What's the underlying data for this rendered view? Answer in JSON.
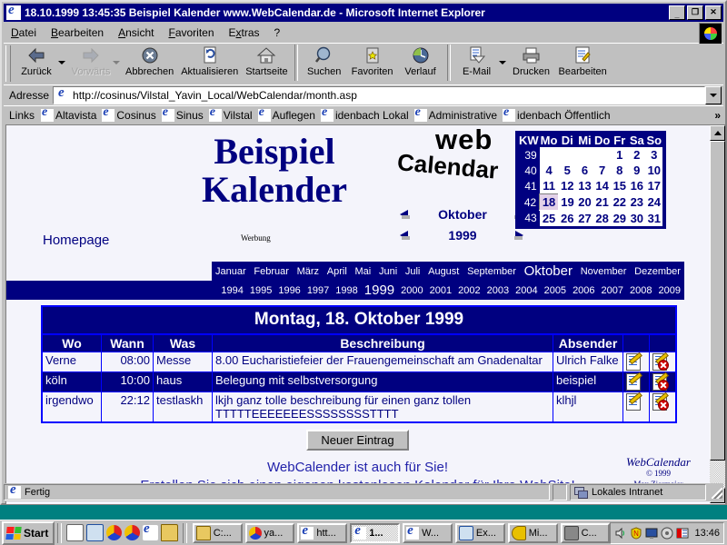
{
  "window": {
    "title": "18.10.1999 13:45:35 Beispiel Kalender www.WebCalendar.de - Microsoft Internet Explorer",
    "minimize_label": "_",
    "restore_label": "❐",
    "close_label": "✕"
  },
  "menubar": {
    "items": [
      {
        "label": "Datei"
      },
      {
        "label": "Bearbeiten"
      },
      {
        "label": "Ansicht"
      },
      {
        "label": "Favoriten"
      },
      {
        "label": "Extras"
      },
      {
        "label": "?"
      }
    ]
  },
  "toolbar": {
    "buttons": [
      {
        "label": "Zurück",
        "icon": "back-arrow-icon",
        "disabled": false,
        "dropdown": true
      },
      {
        "label": "Vorwärts",
        "icon": "forward-arrow-icon",
        "disabled": true,
        "dropdown": true
      },
      {
        "label": "Abbrechen",
        "icon": "stop-icon",
        "disabled": false
      },
      {
        "label": "Aktualisieren",
        "icon": "refresh-icon",
        "disabled": false
      },
      {
        "label": "Startseite",
        "icon": "home-icon",
        "disabled": false
      },
      {
        "label": "Suchen",
        "icon": "search-icon",
        "disabled": false
      },
      {
        "label": "Favoriten",
        "icon": "favorites-star-icon",
        "disabled": false
      },
      {
        "label": "Verlauf",
        "icon": "history-clock-icon",
        "disabled": false
      },
      {
        "label": "E-Mail",
        "icon": "mail-icon",
        "disabled": false,
        "dropdown": true
      },
      {
        "label": "Drucken",
        "icon": "printer-icon",
        "disabled": false
      },
      {
        "label": "Bearbeiten",
        "icon": "edit-page-icon",
        "disabled": false
      }
    ]
  },
  "address": {
    "label": "Adresse",
    "url": "http://cosinus/Vilstal_Yavin_Local/WebCalendar/month.asp"
  },
  "links": {
    "label": "Links",
    "items": [
      {
        "label": "Altavista"
      },
      {
        "label": "Cosinus"
      },
      {
        "label": "Sinus"
      },
      {
        "label": "Vilstal"
      },
      {
        "label": "Auflegen"
      },
      {
        "label": "idenbach Lokal"
      },
      {
        "label": "Administrative"
      },
      {
        "label": "idenbach Öffentlich"
      }
    ],
    "overflow": "»"
  },
  "page": {
    "title_line1": "Beispiel",
    "title_line2": "Kalender",
    "homepage_link": "Homepage",
    "ad_label": "Werbung",
    "logo": {
      "word1": "web",
      "word2": "Calendar"
    },
    "nav": {
      "month": "Oktober",
      "year": "1999",
      "prev_symbol": "◀",
      "next_symbol": "▶"
    },
    "minical": {
      "headers": [
        "KW",
        "Mo",
        "Di",
        "Mi",
        "Do",
        "Fr",
        "Sa",
        "So"
      ],
      "selected_day": "18",
      "rows": [
        {
          "kw": "39",
          "days": [
            "",
            "",
            "",
            "",
            "1",
            "2",
            "3"
          ]
        },
        {
          "kw": "40",
          "days": [
            "4",
            "5",
            "6",
            "7",
            "8",
            "9",
            "10"
          ]
        },
        {
          "kw": "41",
          "days": [
            "11",
            "12",
            "13",
            "14",
            "15",
            "16",
            "17"
          ]
        },
        {
          "kw": "42",
          "days": [
            "18",
            "19",
            "20",
            "21",
            "22",
            "23",
            "24"
          ]
        },
        {
          "kw": "43",
          "days": [
            "25",
            "26",
            "27",
            "28",
            "29",
            "30",
            "31"
          ]
        }
      ]
    },
    "months": [
      "Januar",
      "Februar",
      "März",
      "April",
      "Mai",
      "Juni",
      "Juli",
      "August",
      "September",
      "Oktober",
      "November",
      "Dezember"
    ],
    "current_month": "Oktober",
    "years": [
      "1994",
      "1995",
      "1996",
      "1997",
      "1998",
      "1999",
      "2000",
      "2001",
      "2002",
      "2003",
      "2004",
      "2005",
      "2006",
      "2007",
      "2008",
      "2009"
    ],
    "current_year": "1999",
    "day_title": "Montag, 18. Oktober 1999",
    "table": {
      "headers": [
        "Wo",
        "Wann",
        "Was",
        "Beschreibung",
        "Absender"
      ],
      "rows": [
        {
          "wo": "Verne",
          "wann": "08:00",
          "was": "Messe",
          "beschreibung": "8.00 Eucharistiefeier der Frauengemeinschaft am Gnadenaltar",
          "absender": "Ulrich Falke",
          "highlighted": false
        },
        {
          "wo": "köln",
          "wann": "10:00",
          "was": "haus",
          "beschreibung": "Belegung mit selbstversorgung",
          "absender": "beispiel",
          "highlighted": true
        },
        {
          "wo": "irgendwo",
          "wann": "22:12",
          "was": "testlaskh",
          "beschreibung": "lkjh ganz tolle beschreibung für einen ganz tollen TTTTTEEEEEEESSSSSSSSTTTT",
          "absender": "klhjl",
          "highlighted": false
        }
      ],
      "edit_icon": "edit-entry-icon",
      "delete_icon": "delete-entry-icon"
    },
    "new_entry_button": "Neuer Eintrag",
    "footer_line1": "WebCalender ist auch für Sie!",
    "footer_line2": "Erstellen Sie sich einen eigenen kostenlosen Kalender für Ihre WebSite!",
    "signature": {
      "name": "WebCalendar",
      "copyright": "© 1999",
      "author": "Max Ziermaier"
    }
  },
  "statusbar": {
    "status": "Fertig",
    "zone": "Lokales Intranet"
  },
  "taskbar": {
    "start_label": "Start",
    "quicklaunch": [
      {
        "icon": "notepad-icon"
      },
      {
        "icon": "magnifier-icon"
      },
      {
        "icon": "media-icon"
      },
      {
        "icon": "network-icon"
      },
      {
        "icon": "internet-explorer-icon"
      },
      {
        "icon": "folder-icon"
      }
    ],
    "tasks": [
      {
        "label": "C:...",
        "icon": "folder-icon",
        "active": false
      },
      {
        "label": "ya...",
        "icon": "palette-icon",
        "active": false
      },
      {
        "label": "htt...",
        "icon": "internet-explorer-icon",
        "active": false
      },
      {
        "label": "1...",
        "icon": "internet-explorer-icon",
        "active": true
      },
      {
        "label": "W...",
        "icon": "internet-explorer-icon",
        "active": false
      },
      {
        "label": "Ex...",
        "icon": "explorer-icon",
        "active": false
      },
      {
        "label": "Mi...",
        "icon": "key-icon",
        "active": false
      },
      {
        "label": "C...",
        "icon": "camera-icon",
        "active": false
      }
    ],
    "tray": [
      {
        "icon": "volume-icon"
      },
      {
        "icon": "norton-icon"
      },
      {
        "icon": "display-icon"
      },
      {
        "icon": "disc-icon"
      },
      {
        "icon": "netware-icon"
      }
    ],
    "time": "13:46"
  }
}
